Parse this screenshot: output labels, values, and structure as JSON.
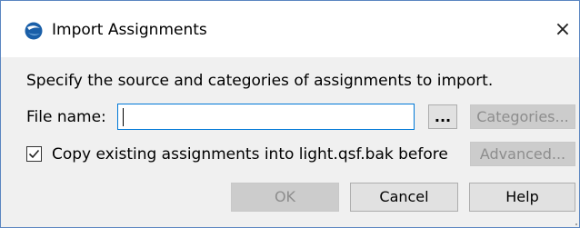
{
  "window": {
    "title": "Import Assignments",
    "close_glyph": "×",
    "app_icon": "quartus-app-icon"
  },
  "dialog": {
    "instruction": "Specify the source and categories of assignments to import.",
    "file_name_label": "File name:",
    "file_name_value": "",
    "browse_label": "...",
    "categories_label": "Categories...",
    "copy_checkbox_checked": true,
    "copy_checkbox_label": "Copy existing assignments into light.qsf.bak before",
    "advanced_label": "Advanced...",
    "ok_label": "OK",
    "cancel_label": "Cancel",
    "help_label": "Help"
  },
  "colors": {
    "focus_border": "#0078d7",
    "disabled_text": "#8d8d8d",
    "window_border": "#5b86c1"
  }
}
